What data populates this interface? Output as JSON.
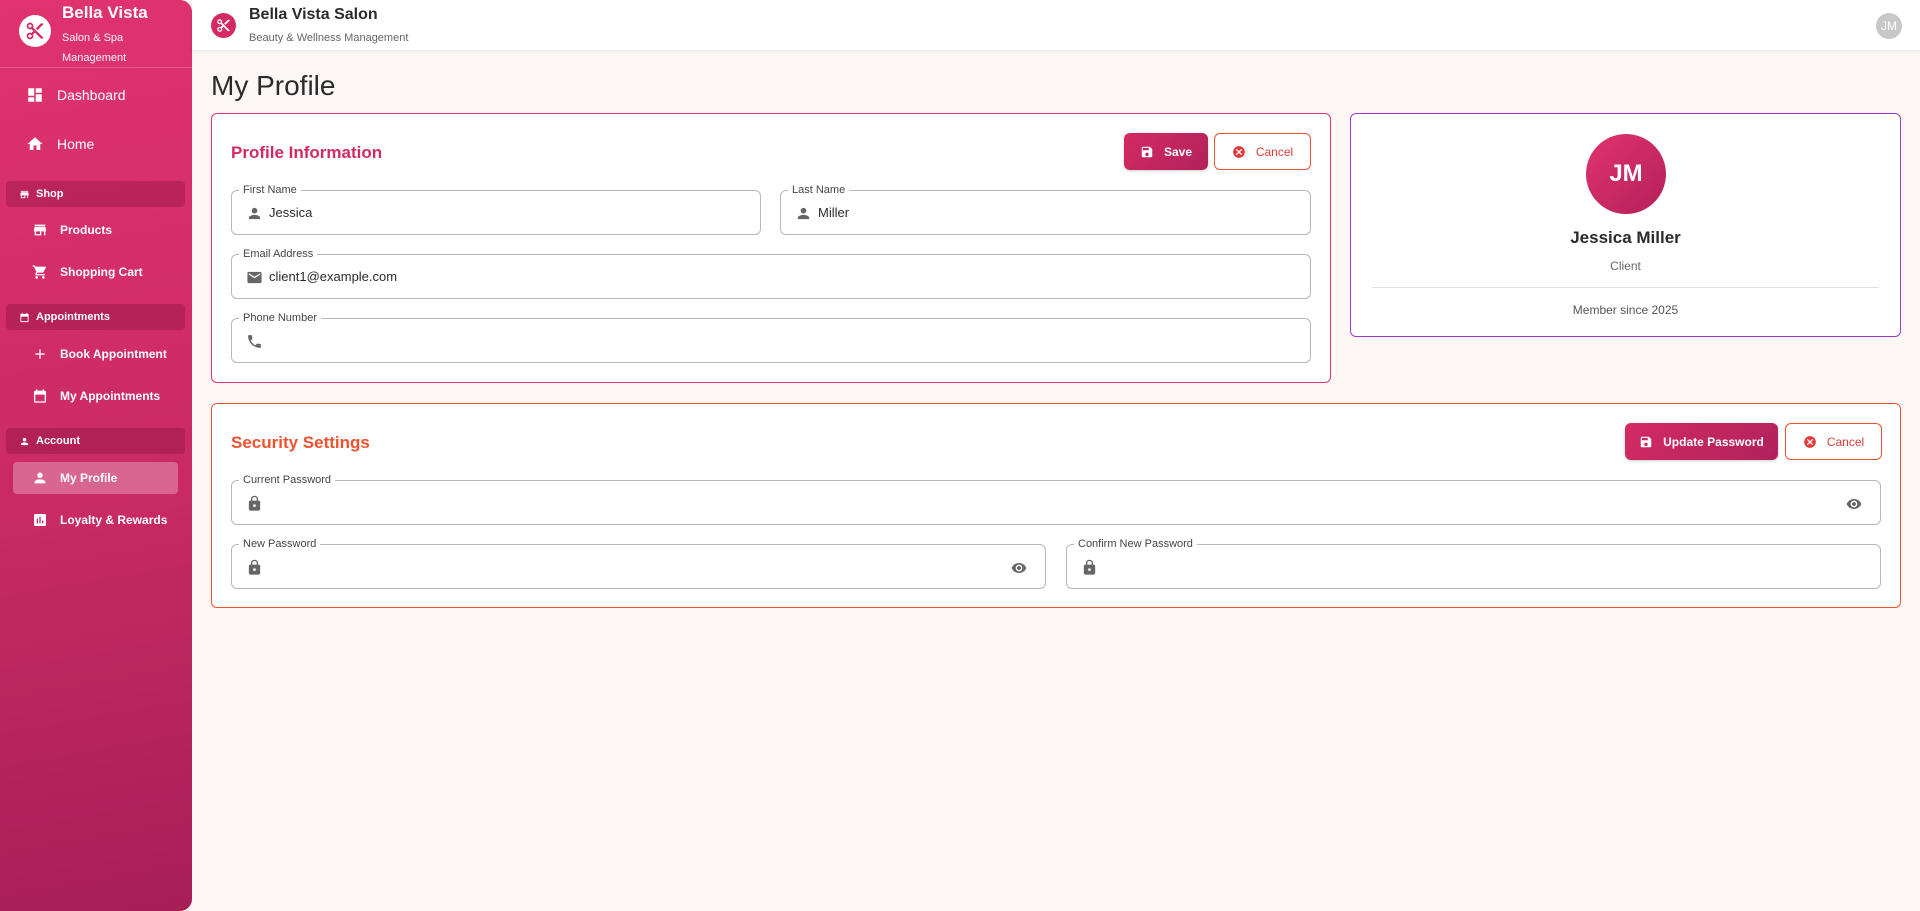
{
  "app": {
    "name": "Bella Vista",
    "subtitle": "Salon & Spa Management"
  },
  "sidebar": {
    "top_items": [
      {
        "label": "Dashboard",
        "icon": "dashboard-icon"
      },
      {
        "label": "Home",
        "icon": "home-icon"
      }
    ],
    "sections": [
      {
        "label": "Shop",
        "icon": "store-icon",
        "items": [
          {
            "label": "Products",
            "icon": "storefront-icon"
          },
          {
            "label": "Shopping Cart",
            "icon": "cart-icon"
          }
        ]
      },
      {
        "label": "Appointments",
        "icon": "calendar-icon",
        "items": [
          {
            "label": "Book Appointment",
            "icon": "plus-icon"
          },
          {
            "label": "My Appointments",
            "icon": "calendar-icon"
          }
        ]
      },
      {
        "label": "Account",
        "icon": "person-icon",
        "items": [
          {
            "label": "My Profile",
            "icon": "person-icon",
            "active": true
          },
          {
            "label": "Loyalty & Rewards",
            "icon": "bar-chart-icon"
          }
        ]
      }
    ]
  },
  "topbar": {
    "title": "Bella Vista Salon",
    "subtitle": "Beauty & Wellness Management",
    "avatar_initials": "JM"
  },
  "page": {
    "title": "My Profile"
  },
  "profile": {
    "title": "Profile Information",
    "save_label": "Save",
    "cancel_label": "Cancel",
    "first_name": {
      "label": "First Name",
      "value": "Jessica"
    },
    "last_name": {
      "label": "Last Name",
      "value": "Miller"
    },
    "email": {
      "label": "Email Address",
      "value": "client1@example.com"
    },
    "phone": {
      "label": "Phone Number",
      "value": ""
    }
  },
  "user_card": {
    "initials": "JM",
    "name": "Jessica Miller",
    "role": "Client",
    "member_since": "Member since 2025"
  },
  "security": {
    "title": "Security Settings",
    "update_label": "Update Password",
    "cancel_label": "Cancel",
    "current_password": {
      "label": "Current Password",
      "value": ""
    },
    "new_password": {
      "label": "New Password",
      "value": ""
    },
    "confirm_password": {
      "label": "Confirm New Password",
      "value": ""
    }
  },
  "colors": {
    "brand": "#d42a64",
    "security_accent": "#f0522e",
    "user_card_border": "#9b3bd0",
    "background": "#fcf7f4"
  }
}
